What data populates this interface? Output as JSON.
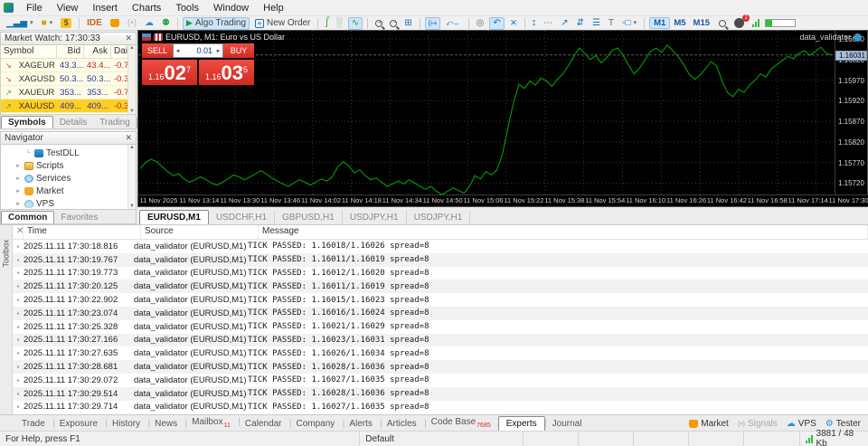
{
  "menu": {
    "items": [
      "File",
      "View",
      "Insert",
      "Charts",
      "Tools",
      "Window",
      "Help"
    ]
  },
  "toolbar": {
    "algo_trading_label": "Algo Trading",
    "new_order_label": "New Order",
    "ide_label": "IDE",
    "timeframes": [
      "M1",
      "M5",
      "M15"
    ],
    "active_timeframe": "M1",
    "notification_count": "1"
  },
  "market_watch": {
    "title": "Market Watch: 17:30:33",
    "columns": [
      "Symbol",
      "Bid",
      "Ask",
      "Dai..."
    ],
    "rows": [
      {
        "symbol": "XAGEUR",
        "bid": "43.3...",
        "ask": "43.4...",
        "daily": "-0.7...",
        "direction": "down",
        "ask_color": "red",
        "selected": false
      },
      {
        "symbol": "XAGUSD",
        "bid": "50.3...",
        "ask": "50.3...",
        "daily": "-0.3...",
        "direction": "down",
        "ask_color": "blue",
        "selected": false
      },
      {
        "symbol": "XAUEUR",
        "bid": "353...",
        "ask": "353...",
        "daily": "-0.7...",
        "direction": "up",
        "ask_color": "blue",
        "selected": false
      },
      {
        "symbol": "XAUUSD",
        "bid": "409...",
        "ask": "409...",
        "daily": "-0.3...",
        "direction": "up",
        "ask_color": "blue",
        "selected": true
      }
    ],
    "tabs": [
      "Symbols",
      "Details",
      "Trading"
    ],
    "active_tab": "Symbols"
  },
  "navigator": {
    "title": "Navigator",
    "items": [
      {
        "label": "TestDLL",
        "icon": "dll",
        "indent": 2,
        "expander": false
      },
      {
        "label": "Scripts",
        "icon": "folder",
        "indent": 1,
        "expander": true
      },
      {
        "label": "Services",
        "icon": "gear",
        "indent": 1,
        "expander": true
      },
      {
        "label": "Market",
        "icon": "bag",
        "indent": 1,
        "expander": true
      },
      {
        "label": "VPS",
        "icon": "cloud",
        "indent": 1,
        "expander": true
      }
    ],
    "tabs": [
      "Common",
      "Favorites"
    ],
    "active_tab": "Common"
  },
  "chart": {
    "title": "EURUSD, M1: Euro vs US Dollar",
    "ea_label": "data_validator",
    "one_click": {
      "sell_label": "SELL",
      "buy_label": "BUY",
      "volume": "0.01",
      "sell_price_small": "1.16",
      "sell_price_big": "02",
      "sell_price_sup": "7",
      "buy_price_small": "1.16",
      "buy_price_big": "03",
      "buy_price_sup": "5"
    }
  },
  "chart_data": {
    "type": "line",
    "title": "EURUSD, M1: Euro vs US Dollar",
    "symbol": "EURUSD",
    "timeframe": "M1",
    "line_color": "#00a000",
    "grid": true,
    "x_ticks": [
      "11 Nov 2025",
      "11 Nov 13:14",
      "11 Nov 13:30",
      "11 Nov 13:46",
      "11 Nov 14:02",
      "11 Nov 14:18",
      "11 Nov 14:34",
      "11 Nov 14:50",
      "11 Nov 15:06",
      "11 Nov 15:22",
      "11 Nov 15:38",
      "11 Nov 15:54",
      "11 Nov 16:10",
      "11 Nov 16:26",
      "11 Nov 16:42",
      "11 Nov 16:58",
      "11 Nov 17:14",
      "11 Nov 17:30"
    ],
    "y_ticks": [
      "1.16070",
      "1.16020",
      "1.15970",
      "1.15920",
      "1.15870",
      "1.15820",
      "1.15770",
      "1.15720"
    ],
    "ylim": [
      1.1569,
      1.1609
    ],
    "current_bid": "1.16031",
    "values": [
      1.15755,
      1.1577,
      1.15778,
      1.15772,
      1.1576,
      1.15748,
      1.15738,
      1.15742,
      1.1573,
      1.15722,
      1.15728,
      1.15735,
      1.15728,
      1.1572,
      1.15715,
      1.15722,
      1.1573,
      1.1574,
      1.15735,
      1.15728,
      1.15735,
      1.15742,
      1.1575,
      1.15742,
      1.15732,
      1.15725,
      1.15718,
      1.15712,
      1.1572,
      1.15728,
      1.15722,
      1.15715,
      1.15722,
      1.1573,
      1.15725,
      1.15735,
      1.1576,
      1.15772,
      1.15762,
      1.15745,
      1.15752,
      1.15738,
      1.15728,
      1.15732,
      1.15722,
      1.15712,
      1.15718,
      1.15725,
      1.15718,
      1.15728,
      1.1572,
      1.15712,
      1.15705,
      1.15712,
      1.157,
      1.15692,
      1.157,
      1.15708,
      1.15702,
      1.15695,
      1.15712,
      1.15738,
      1.1573,
      1.15748,
      1.1574,
      1.15752,
      1.1579,
      1.15855,
      1.15915,
      1.1596,
      1.1595,
      1.15968,
      1.15958,
      1.15975,
      1.15968,
      1.15955,
      1.15972,
      1.15985,
      1.16005,
      1.16028,
      1.16048,
      1.16035,
      1.1602,
      1.1603,
      1.16012,
      1.16025,
      1.16042,
      1.16048,
      1.1603,
      1.16005,
      1.15985,
      1.16,
      1.1602,
      1.1604,
      1.16048,
      1.16038,
      1.16055,
      1.16042,
      1.16028,
      1.16008,
      1.15985,
      1.15972,
      1.15982,
      1.15998,
      1.16015,
      1.16005,
      1.15968,
      1.1594,
      1.1593,
      1.15948,
      1.1594,
      1.15958,
      1.1597,
      1.15985,
      1.15978,
      1.15998,
      1.16008,
      1.16018,
      1.16028,
      1.16022,
      1.16035,
      1.16042,
      1.1603,
      1.1604,
      1.1605,
      1.16035,
      1.16031
    ]
  },
  "chart_tabs": {
    "tabs": [
      "EURUSD,M1",
      "USDCHF,H1",
      "GBPUSD,H1",
      "USDJPY,H1",
      "USDJPY,H1"
    ],
    "active": "EURUSD,M1"
  },
  "toolbox": {
    "vertical_label": "Toolbox",
    "columns": [
      "Time",
      "Source",
      "Message"
    ],
    "rows": [
      {
        "time": "2025.11.11 17:30:18.816",
        "source": "data_validator (EURUSD,M1)",
        "message": "TICK PASSED: 1.16018/1.16026 spread=8"
      },
      {
        "time": "2025.11.11 17:30:19.767",
        "source": "data_validator (EURUSD,M1)",
        "message": "TICK PASSED: 1.16011/1.16019 spread=8"
      },
      {
        "time": "2025.11.11 17:30:19.773",
        "source": "data_validator (EURUSD,M1)",
        "message": "TICK PASSED: 1.16012/1.16020 spread=8"
      },
      {
        "time": "2025.11.11 17:30:20.125",
        "source": "data_validator (EURUSD,M1)",
        "message": "TICK PASSED: 1.16011/1.16019 spread=8"
      },
      {
        "time": "2025.11.11 17:30:22.902",
        "source": "data_validator (EURUSD,M1)",
        "message": "TICK PASSED: 1.16015/1.16023 spread=8"
      },
      {
        "time": "2025.11.11 17:30:23.074",
        "source": "data_validator (EURUSD,M1)",
        "message": "TICK PASSED: 1.16016/1.16024 spread=8"
      },
      {
        "time": "2025.11.11 17:30:25.328",
        "source": "data_validator (EURUSD,M1)",
        "message": "TICK PASSED: 1.16021/1.16029 spread=8"
      },
      {
        "time": "2025.11.11 17:30:27.166",
        "source": "data_validator (EURUSD,M1)",
        "message": "TICK PASSED: 1.16023/1.16031 spread=8"
      },
      {
        "time": "2025.11.11 17:30:27.635",
        "source": "data_validator (EURUSD,M1)",
        "message": "TICK PASSED: 1.16026/1.16034 spread=8"
      },
      {
        "time": "2025.11.11 17:30:28.681",
        "source": "data_validator (EURUSD,M1)",
        "message": "TICK PASSED: 1.16028/1.16036 spread=8"
      },
      {
        "time": "2025.11.11 17:30:29.072",
        "source": "data_validator (EURUSD,M1)",
        "message": "TICK PASSED: 1.16027/1.16035 spread=8"
      },
      {
        "time": "2025.11.11 17:30:29.514",
        "source": "data_validator (EURUSD,M1)",
        "message": "TICK PASSED: 1.16028/1.16036 spread=8"
      },
      {
        "time": "2025.11.11 17:30:29.714",
        "source": "data_validator (EURUSD,M1)",
        "message": "TICK PASSED: 1.16027/1.16035 spread=8"
      }
    ]
  },
  "bottom_tabs": {
    "tabs": [
      {
        "label": "Trade",
        "badge": ""
      },
      {
        "label": "Exposure",
        "badge": ""
      },
      {
        "label": "History",
        "badge": ""
      },
      {
        "label": "News",
        "badge": ""
      },
      {
        "label": "Mailbox",
        "badge": "11"
      },
      {
        "label": "Calendar",
        "badge": ""
      },
      {
        "label": "Company",
        "badge": ""
      },
      {
        "label": "Alerts",
        "badge": ""
      },
      {
        "label": "Articles",
        "badge": ""
      },
      {
        "label": "Code Base",
        "badge": "7685"
      },
      {
        "label": "Experts",
        "badge": ""
      },
      {
        "label": "Journal",
        "badge": ""
      }
    ],
    "active_tab": "Experts",
    "right_buttons": [
      {
        "label": "Market",
        "icon": "bag-icon",
        "disabled": false
      },
      {
        "label": "Signals",
        "icon": "signals-icon",
        "disabled": true
      },
      {
        "label": "VPS",
        "icon": "cloud-icon",
        "disabled": false
      },
      {
        "label": "Tester",
        "icon": "gear-icon",
        "disabled": false
      }
    ]
  },
  "status_bar": {
    "help_text": "For Help, press F1",
    "profile": "Default",
    "traffic": "3881 / 48 Kb"
  }
}
